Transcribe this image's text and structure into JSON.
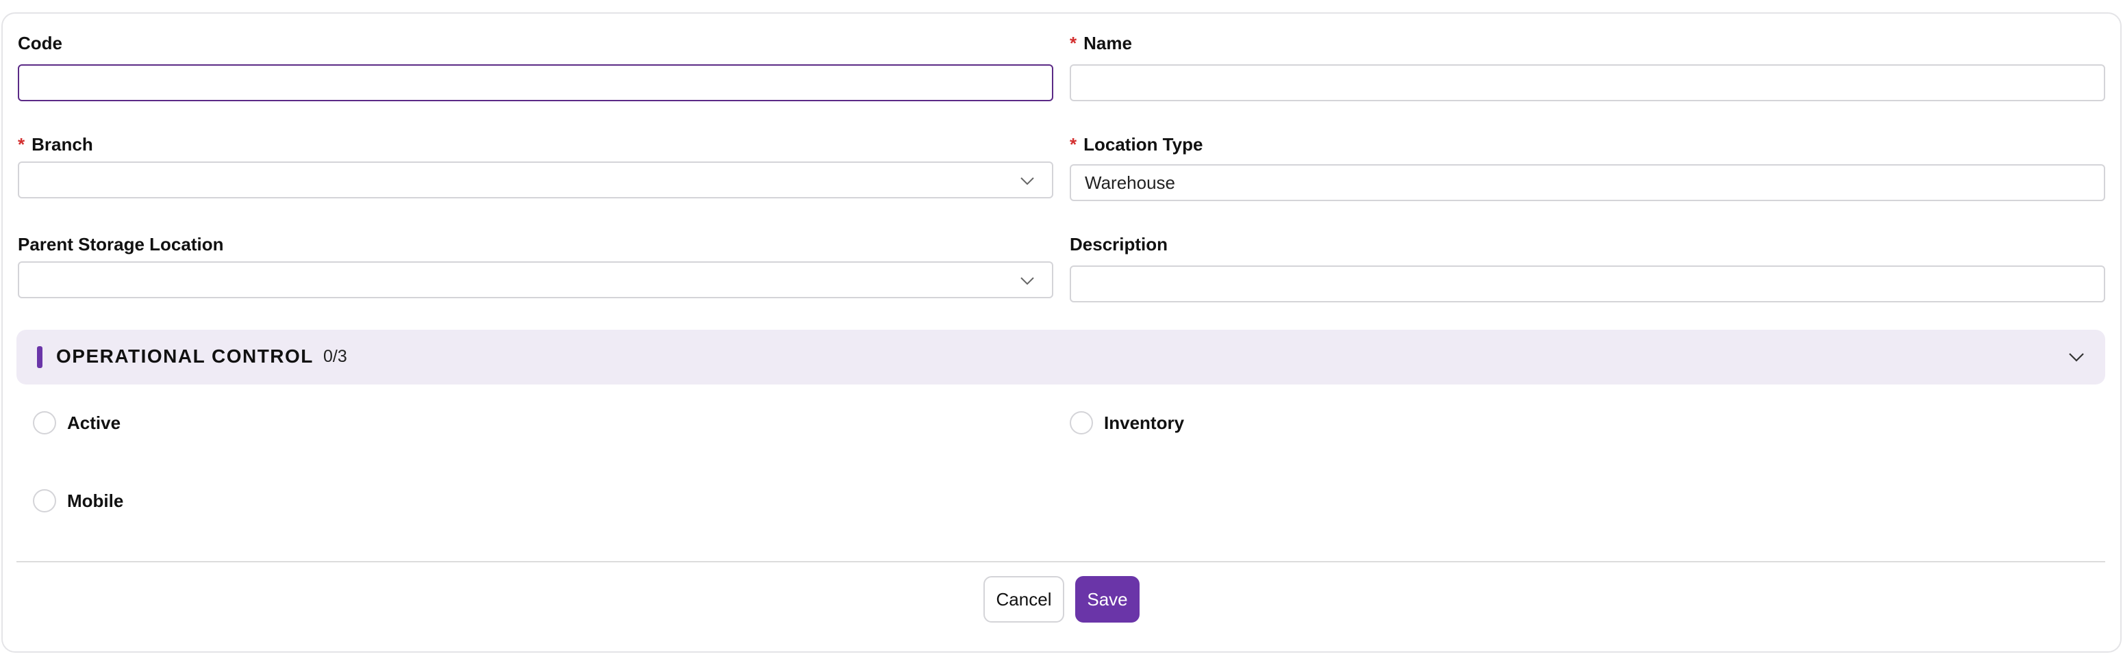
{
  "form": {
    "code": {
      "label": "Code",
      "value": ""
    },
    "name": {
      "label": "Name",
      "required_mark": "*",
      "value": ""
    },
    "branch": {
      "label": "Branch",
      "required_mark": "*",
      "value": ""
    },
    "location_type": {
      "label": "Location Type",
      "required_mark": "*",
      "value": "Warehouse"
    },
    "parent_storage_location": {
      "label": "Parent Storage Location",
      "value": ""
    },
    "description": {
      "label": "Description",
      "value": ""
    }
  },
  "operational_control": {
    "title": "OPERATIONAL CONTROL",
    "count": "0/3",
    "items": [
      {
        "label": "Active",
        "checked": false
      },
      {
        "label": "Inventory",
        "checked": false
      },
      {
        "label": "Mobile",
        "checked": false
      }
    ]
  },
  "actions": {
    "cancel_label": "Cancel",
    "save_label": "Save"
  },
  "colors": {
    "accent": "#6a35a8",
    "required": "#d32f2f",
    "section_bg": "#efebf5",
    "focus_border": "#5b2a86"
  },
  "icons": {
    "select_chevron": "chevron-down-icon",
    "section_chevron": "chevron-down-icon"
  }
}
